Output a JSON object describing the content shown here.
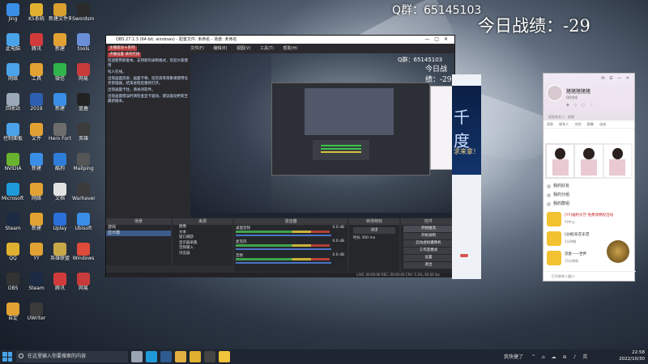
{
  "overlay": {
    "qq_group": "Q群：65145103",
    "today_score": "今日战绩：-29"
  },
  "desktop_icons": [
    {
      "label": "Jing",
      "color": "#3a8ee6"
    },
    {
      "label": "K5系统",
      "color": "#e0b030"
    },
    {
      "label": "新建文件夹",
      "color": "#d9a030"
    },
    {
      "label": "Swordsman",
      "color": "#2b2b2b"
    },
    {
      "label": "此电脑",
      "color": "#4aa3e8"
    },
    {
      "label": "腾讯",
      "color": "#d23b3b"
    },
    {
      "label": "新建",
      "color": "#e2a233"
    },
    {
      "label": "tools",
      "color": "#6a8fd8"
    },
    {
      "label": "网络",
      "color": "#4aa3e8"
    },
    {
      "label": "工具",
      "color": "#e2a233"
    },
    {
      "label": "微信",
      "color": "#31b34b"
    },
    {
      "label": "网易",
      "color": "#c83b3b"
    },
    {
      "label": "回收站",
      "color": "#9aa8b8"
    },
    {
      "label": "2019",
      "color": "#2d5fb0"
    },
    {
      "label": "新建",
      "color": "#3a8ee6"
    },
    {
      "label": "蓝叠",
      "color": "#222"
    },
    {
      "label": "控制面板",
      "color": "#4aa3e8"
    },
    {
      "label": "文件",
      "color": "#e2a233"
    },
    {
      "label": "Hero Fortune",
      "color": "#6d6d6d"
    },
    {
      "label": "英雄",
      "color": "#3b3b3b"
    },
    {
      "label": "NVIDIA",
      "color": "#6ab32e"
    },
    {
      "label": "新建",
      "color": "#3a8ee6"
    },
    {
      "label": "酷狗",
      "color": "#2e7dd8"
    },
    {
      "label": "Mailping",
      "color": "#555"
    },
    {
      "label": "Microsoft Edge",
      "color": "#1f9ad8"
    },
    {
      "label": "网络",
      "color": "#e2a233"
    },
    {
      "label": "文档",
      "color": "#e2e2e2"
    },
    {
      "label": "Warhaven Playtest",
      "color": "#3b3b3b"
    },
    {
      "label": "Steam",
      "color": "#1c2a44"
    },
    {
      "label": "新建",
      "color": "#e2a233"
    },
    {
      "label": "Uplay",
      "color": "#2b6fd8"
    },
    {
      "label": "Ubisoft",
      "color": "#3a8ee6"
    },
    {
      "label": "QQ",
      "color": "#e0b030"
    },
    {
      "label": "YY",
      "color": "#e2a233"
    },
    {
      "label": "英雄联盟",
      "color": "#c9a84a"
    },
    {
      "label": "Windows",
      "color": "#e04b3b"
    },
    {
      "label": "OBS",
      "color": "#333"
    },
    {
      "label": "Steam",
      "color": "#1c2a44"
    },
    {
      "label": "腾讯",
      "color": "#d23b3b"
    },
    {
      "label": "网易",
      "color": "#c83b3b"
    },
    {
      "label": "自定",
      "color": "#e2a233"
    },
    {
      "label": "UWriter",
      "color": "#3b3b3b"
    }
  ],
  "obs": {
    "title": "OBS 27.1.3 (64-bit, windows) - 配置文件: 未命名 - 场景: 未命名",
    "menu": [
      "文件(F)",
      "编辑(E)",
      "视图(V)",
      "工具(T)",
      "帮助(H)"
    ],
    "left_text": [
      "主播驱动十系列",
      "点播设置 请勿打扰",
      "欢迎使用新版本，支持新的录制格式，欢迎大家使用",
      "有人在线。",
      "出现画面黑屏、画面卡顿、延迟高等现象请使用任务管理器，结束进程后重新打开。",
      "出现画面卡住，请关闭软件。",
      "出现画面错误时请检查显卡驱动，建议驱动更新至最新版本。"
    ],
    "preview": {
      "qq_group": "Q群：65145103",
      "today_score": "今日战绩：-29"
    },
    "docks": {
      "scenes": {
        "title": "场景",
        "items": [
          "游戏",
          "显示器"
        ]
      },
      "sources": {
        "title": "来源",
        "items": [
          "图像",
          "文本",
          "窗口捕获",
          "显示器采集",
          "音频输入",
          "浏览器"
        ]
      },
      "mixer": {
        "title": "混音器",
        "channels": [
          {
            "name": "桌面音频",
            "db": "0.0 dB"
          },
          {
            "name": "麦克风",
            "db": "0.0 dB"
          },
          {
            "name": "音频",
            "db": "0.0 dB"
          }
        ]
      },
      "transitions": {
        "title": "转场特效",
        "type": "淡出",
        "duration_label": "时长",
        "duration": "300 ms"
      },
      "controls": {
        "title": "控件",
        "buttons": [
          "开始推流",
          "开始录制",
          "启动虚拟摄像机",
          "工作室模式",
          "设置",
          "退出"
        ]
      }
    },
    "status": "LIVE: 00:00:00   REC: 00:00:00   CPU: 5.4%, 60.00 fps"
  },
  "browser": {
    "big_text": "千度",
    "sub_text": "求来拿！"
  },
  "qq_panel": {
    "name": "猪猪猪猪猪",
    "subtitle": "QQ空间",
    "search_placeholder": "搜索联系人、群聊",
    "tabs": [
      "消息",
      "联系人",
      "空间",
      "群聊",
      "动态"
    ],
    "list": [
      "我的好友",
      "我的分组",
      "我的群组"
    ],
    "items": [
      {
        "title": "[YY]福利大厅·免费领特权活动",
        "sub": "YY中心"
      },
      {
        "title": "[分组]乐在乐范",
        "sub": "1分钟前"
      },
      {
        "title": "流星——世界",
        "sub": "15分钟前"
      }
    ],
    "bottom_placeholder": "打开联系人窗口"
  },
  "taskbar": {
    "search_placeholder": "在这里输入你要搜索的内容",
    "apps": [
      {
        "name": "任务视图",
        "color": "#9aa4b2"
      },
      {
        "name": "Edge",
        "color": "#1f9ad8"
      },
      {
        "name": "Steam",
        "color": "#2e5b8f"
      },
      {
        "name": "文件资源管理器",
        "color": "#e2b040"
      },
      {
        "name": "QQ",
        "color": "#e0b030"
      },
      {
        "name": "OBS",
        "color": "#444"
      },
      {
        "name": "YY",
        "color": "#f0c33a"
      }
    ],
    "tray_text": "我快捷了",
    "tray_icons": [
      "^",
      "⌂",
      "☁",
      "⊕",
      "♪",
      "英"
    ],
    "time": "22:58",
    "date": "2022/10/30"
  }
}
